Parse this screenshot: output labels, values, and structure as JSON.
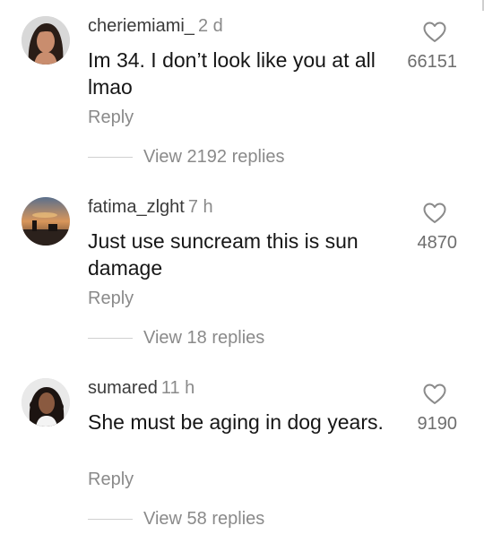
{
  "comments": [
    {
      "username": "cheriemiami_",
      "time": "2 d",
      "text": "Im 34. I don’t look like you at all lmao",
      "reply_label": "Reply",
      "view_replies": "View 2192 replies",
      "likes": "66151",
      "avatar_icon": "avatar-dark-hair-woman"
    },
    {
      "username": "fatima_zlght",
      "time": "7 h",
      "text": "Just use suncream this is sun damage",
      "reply_label": "Reply",
      "view_replies": "View 18 replies",
      "likes": "4870",
      "avatar_icon": "avatar-sunset-scene"
    },
    {
      "username": "sumared",
      "time": "11 h",
      "text": "She must be aging in dog years.",
      "reply_label": "Reply",
      "view_replies": "View 58 replies",
      "likes": "9190",
      "avatar_icon": "avatar-curly-hair-woman"
    }
  ],
  "colors": {
    "text_primary": "#161616",
    "text_secondary": "#8a8a8a",
    "username": "#3b3b3b",
    "like_count": "#6e6e6e",
    "divider": "#d0d0d0"
  },
  "icons": {
    "like": "heart-outline-icon"
  }
}
